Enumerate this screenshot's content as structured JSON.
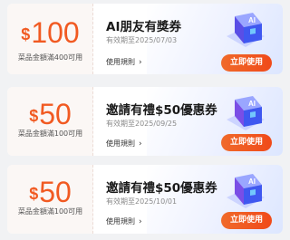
{
  "coupons": [
    {
      "currency": "$",
      "amount": "100",
      "condition": "菜品金額滿400可用",
      "title": "AI朋友有獎券",
      "validity": "有效期至2025/07/03",
      "rules_label": "使用規則",
      "rules_icon": "chevron-right-icon",
      "use_label": "立即使用",
      "badge_text": "AI"
    },
    {
      "currency": "$",
      "amount": "50",
      "condition": "菜品金額滿100可用",
      "title": "邀請有禮$50優惠券",
      "validity": "有效期至2025/09/25",
      "rules_label": "使用規則",
      "rules_icon": "chevron-right-icon",
      "use_label": "立即使用",
      "badge_text": "AI"
    },
    {
      "currency": "$",
      "amount": "50",
      "condition": "菜品金額滿100可用",
      "title": "邀請有禮$50優惠券",
      "validity": "有效期至2025/10/01",
      "rules_label": "使用規則",
      "rules_icon": "chevron-right-icon",
      "use_label": "立即使用",
      "badge_text": "AI"
    }
  ],
  "colors": {
    "accent": "#f15a22",
    "button": "#f05220",
    "background": "#f1f2f4",
    "cube_blue": "#4a5cf0",
    "cube_purple": "#7a5cf0"
  }
}
